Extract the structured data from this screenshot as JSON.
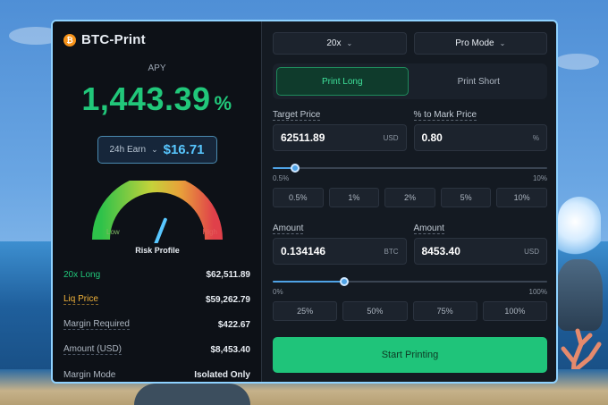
{
  "brand": {
    "name": "BTC-Print",
    "coin_glyph": "₿",
    "coin_color": "#f7931a"
  },
  "apy": {
    "label": "APY",
    "value": "1,443.39",
    "unit": "%"
  },
  "earn": {
    "period": "24h Earn",
    "value": "$16.71"
  },
  "gauge": {
    "low_label": "Low",
    "high_label": "High",
    "title": "Risk Profile",
    "level": 0.62
  },
  "stats": [
    {
      "label": "20x Long",
      "value": "$62,511.89",
      "style": "green"
    },
    {
      "label": "Liq Price",
      "value": "$59,262.79",
      "style": "amber"
    },
    {
      "label": "Margin Required",
      "value": "$422.67",
      "style": "dashed"
    },
    {
      "label": "Amount (USD)",
      "value": "$8,453.40",
      "style": "dashed"
    },
    {
      "label": "Margin Mode",
      "value": "Isolated Only",
      "style": "plain"
    }
  ],
  "controls": {
    "leverage": "20x",
    "mode": "Pro Mode"
  },
  "side_toggle": {
    "long_label": "Print Long",
    "short_label": "Print Short",
    "active": "long"
  },
  "target": {
    "price_label": "Target Price",
    "price_value": "62511.89",
    "price_unit": "USD",
    "pct_label": "% to Mark Price",
    "pct_value": "0.80",
    "pct_unit": "%",
    "slider_level": 0.08,
    "slider_min": "0.5%",
    "slider_max": "10%",
    "presets": [
      "0.5%",
      "1%",
      "2%",
      "5%",
      "10%"
    ]
  },
  "amount": {
    "btc_label": "Amount",
    "btc_value": "0.134146",
    "btc_unit": "BTC",
    "usd_label": "Amount",
    "usd_value": "8453.40",
    "usd_unit": "USD",
    "slider_level": 0.26,
    "slider_min": "0%",
    "slider_max": "100%",
    "presets": [
      "25%",
      "50%",
      "75%",
      "100%"
    ]
  },
  "start_button": "Start Printing"
}
